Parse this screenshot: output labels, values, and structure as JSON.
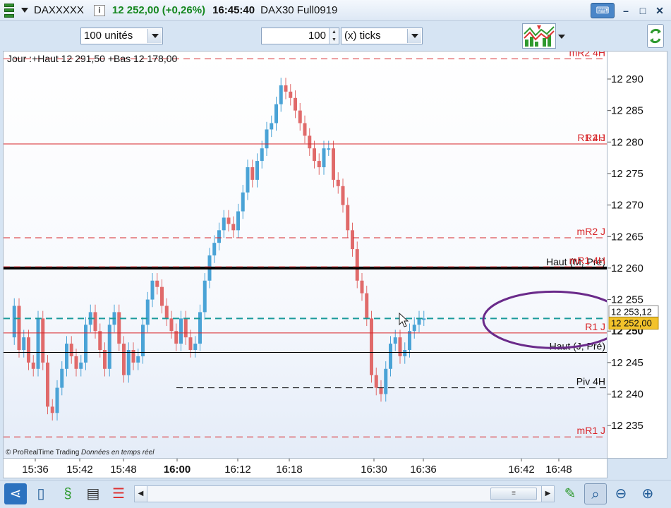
{
  "titlebar": {
    "ticker": "DAXXXXX",
    "info_icon": "i",
    "price": "12 252,00 (+0,26%)",
    "time": "16:45:40",
    "description": "DAX30 Full0919",
    "keyboard_icon": "keyboard-icon",
    "minimize": "–",
    "maximize": "□",
    "close": "✕"
  },
  "toolbar": {
    "units_value": "100 unités",
    "ticks_value": "100",
    "ticks_unit": "(x) ticks"
  },
  "chart": {
    "header": "Jour :+Haut 12 291,50 +Bas 12 178,00",
    "copyright": "© ProRealTime Trading",
    "realtime": "Données en temps réel",
    "cursor_price": "12 253,12",
    "last_price": "12 252,00",
    "colors": {
      "up": "#4aa3d6",
      "down": "#e06a6a",
      "resistance": "#d8262a",
      "support": "#d8262a",
      "current_line": "#1a9a9a",
      "highlight_ellipse": "#6a2a8a",
      "last_price_bg": "#f2c22b"
    },
    "levels": [
      {
        "label": "mR2 4H",
        "price": 12293.2,
        "style": "dashed",
        "color": "#d8262a"
      },
      {
        "label": "R1 4H",
        "price": 12279.7,
        "style": "solid",
        "color": "#d8262a"
      },
      {
        "label": "R2 J",
        "price": 12279.7,
        "style": "dashed",
        "color": "#d8262a"
      },
      {
        "label": "mR2 J",
        "price": 12264.8,
        "style": "dashed",
        "color": "#d8262a"
      },
      {
        "label": "Haut (M, Pré)",
        "price": 12260.0,
        "style": "bold",
        "color": "#000000"
      },
      {
        "label": "mR1 4H",
        "price": 12260.2,
        "style": "dashed",
        "color": "#d8262a"
      },
      {
        "label": "R1 J",
        "price": 12249.7,
        "style": "solid",
        "color": "#d8262a"
      },
      {
        "label": "Haut (J, Pré)",
        "price": 12246.6,
        "style": "solid",
        "color": "#000000"
      },
      {
        "label": "Piv 4H",
        "price": 12241.0,
        "style": "dashed",
        "color": "#000000"
      },
      {
        "label": "mR1 J",
        "price": 12233.2,
        "style": "dashed",
        "color": "#d8262a"
      }
    ]
  },
  "price_axis": {
    "ticks": [
      "12 290",
      "12 285",
      "12 280",
      "12 275",
      "12 270",
      "12 265",
      "12 260",
      "12 255",
      "12 250",
      "12 245",
      "12 240",
      "12 235"
    ]
  },
  "time_axis": {
    "ticks": [
      "15:36",
      "15:42",
      "15:48",
      "16:00",
      "16:12",
      "16:18",
      "16:30",
      "16:36",
      "16:42",
      "16:48"
    ]
  },
  "bottom_toolbar": {
    "icons": [
      "share-icon",
      "layout-icon",
      "indicator-icon",
      "order-book-icon",
      "alert-icon",
      "drawing-tools-icon",
      "zoom-select-icon",
      "zoom-out-icon",
      "zoom-in-icon"
    ]
  }
}
